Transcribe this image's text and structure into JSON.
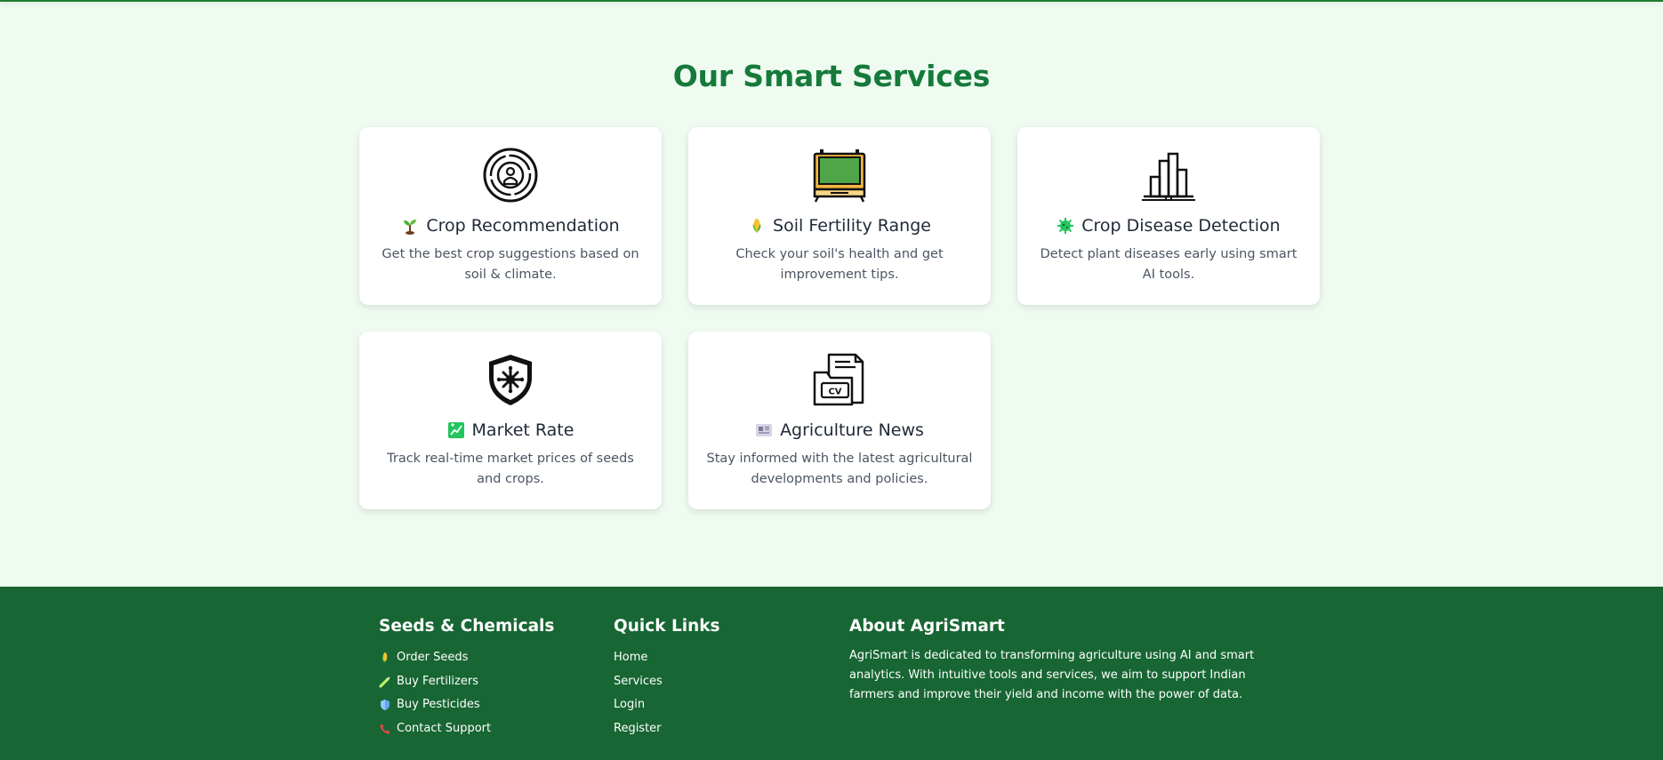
{
  "services_section": {
    "title": "Our Smart Services",
    "cards": [
      {
        "icon": "radar-target-icon",
        "emoji": "seedling-emoji",
        "title": "Crop Recommendation",
        "description": "Get the best crop suggestions based on soil & climate."
      },
      {
        "icon": "soil-monitor-icon",
        "emoji": "corn-emoji",
        "title": "Soil Fertility Range",
        "description": "Check your soil's health and get improvement tips."
      },
      {
        "icon": "bar-building-icon",
        "emoji": "microbe-emoji",
        "title": "Crop Disease Detection",
        "description": "Detect plant diseases early using smart AI tools."
      },
      {
        "icon": "shield-virus-icon",
        "emoji": "chart-emoji",
        "title": "Market Rate",
        "description": "Track real-time market prices of seeds and crops."
      },
      {
        "icon": "folder-cv-icon",
        "emoji": "newspaper-emoji",
        "title": "Agriculture News",
        "description": "Stay informed with the latest agricultural developments and policies."
      }
    ]
  },
  "footer": {
    "seeds": {
      "heading": "Seeds & Chemicals",
      "links": [
        {
          "icon": "corn-icon",
          "label": "Order Seeds"
        },
        {
          "icon": "syringe-icon",
          "label": "Buy Fertilizers"
        },
        {
          "icon": "shield-icon",
          "label": "Buy Pesticides"
        },
        {
          "icon": "phone-icon",
          "label": "Contact Support"
        }
      ]
    },
    "quick_links": {
      "heading": "Quick Links",
      "links": [
        "Home",
        "Services",
        "Login",
        "Register"
      ]
    },
    "about": {
      "heading": "About AgriSmart",
      "text": "AgriSmart is dedicated to transforming agriculture using AI and smart analytics. With intuitive tools and services, we aim to support Indian farmers and improve their yield and income with the power of data."
    }
  },
  "colors": {
    "background": "#effbf1",
    "accent_green": "#157a3a",
    "footer_green": "#176633"
  }
}
